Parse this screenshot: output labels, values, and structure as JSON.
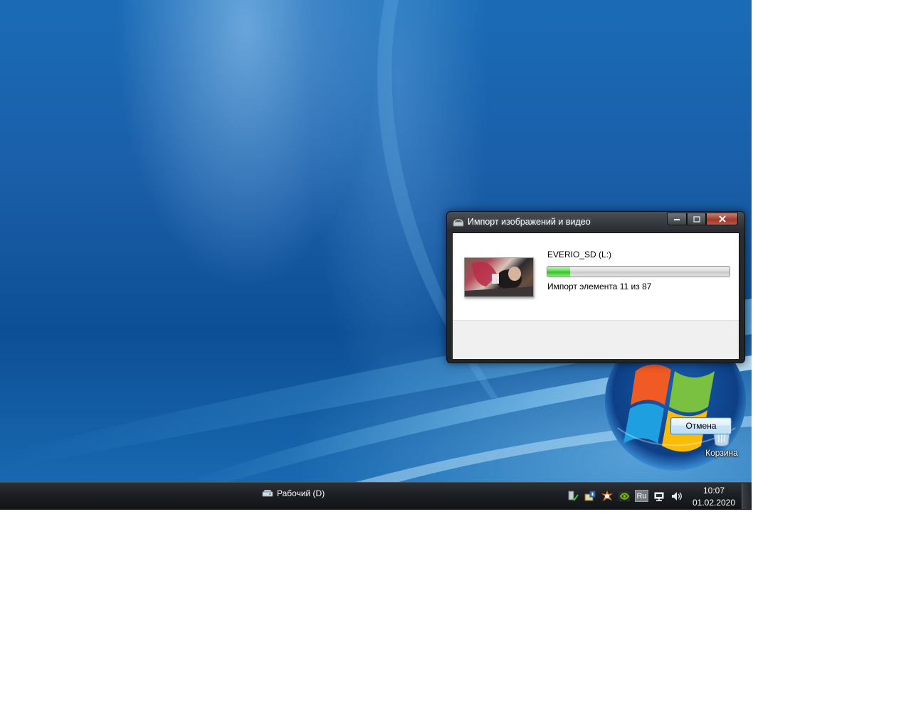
{
  "desktop": {
    "recycle_bin_label": "Корзина"
  },
  "taskbar": {
    "desktop_button_label": "Рабочий (D)",
    "language": "Ru",
    "clock_time": "10:07",
    "clock_date": "01.02.2020",
    "tray_icons": [
      "safely-remove-hardware-icon",
      "update-notification-icon",
      "avast-antivirus-icon",
      "nvidia-icon",
      "language-indicator",
      "network-icon",
      "volume-icon"
    ]
  },
  "dialog": {
    "title": "Импорт изображений и видео",
    "device_label": "EVERIO_SD (L:)",
    "progress_current": 11,
    "progress_total": 87,
    "status_text": "Импорт элемента 11 из 87",
    "cancel_label": "Отмена"
  },
  "colors": {
    "progress_green": "#33c426",
    "taskbar_dark": "#1c1f22",
    "desktop_blue": "#1a5ea8"
  }
}
